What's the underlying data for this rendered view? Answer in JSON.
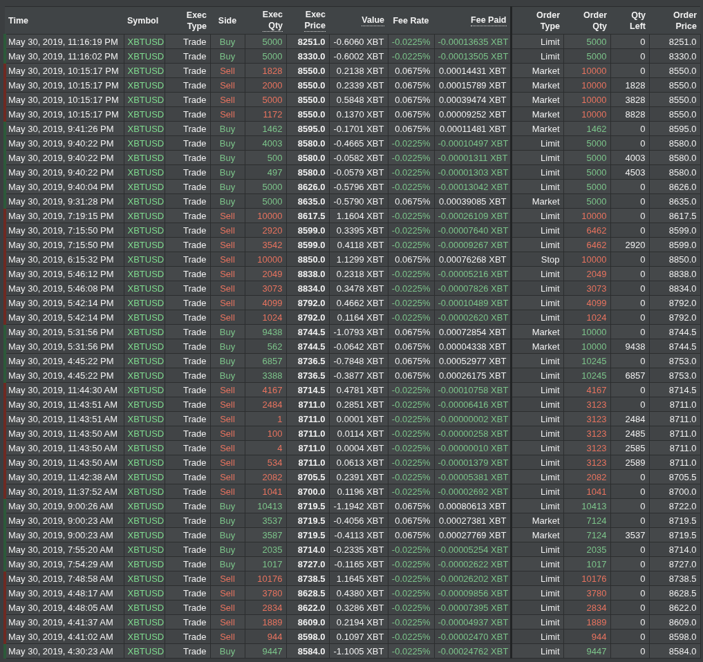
{
  "table": {
    "columns": [
      {
        "lines": [
          "Time"
        ],
        "kind": "time",
        "tooltip": false
      },
      {
        "lines": [
          "Symbol"
        ],
        "kind": "symbol",
        "tooltip": false
      },
      {
        "lines": [
          "Exec",
          "Type"
        ],
        "kind": "plain",
        "tooltip": false
      },
      {
        "lines": [
          "Side"
        ],
        "kind": "side",
        "tooltip": false
      },
      {
        "lines": [
          "Exec",
          "Qty"
        ],
        "kind": "side",
        "tooltip": true
      },
      {
        "lines": [
          "Exec",
          "Price"
        ],
        "kind": "bold",
        "tooltip": true
      },
      {
        "lines": [
          "Value"
        ],
        "kind": "plain",
        "tooltip": true
      },
      {
        "lines": [
          "Fee Rate"
        ],
        "kind": "fee",
        "tooltip": false
      },
      {
        "lines": [
          "Fee Paid"
        ],
        "kind": "fee",
        "tooltip": true
      },
      {
        "lines": [
          "Order",
          "Type"
        ],
        "kind": "plain",
        "tooltip": false
      },
      {
        "lines": [
          "Order",
          "Qty"
        ],
        "kind": "side",
        "tooltip": false
      },
      {
        "lines": [
          "Qty",
          "Left"
        ],
        "kind": "plain",
        "tooltip": false
      },
      {
        "lines": [
          "Order",
          "Price"
        ],
        "kind": "plain",
        "tooltip": false
      }
    ],
    "rows": [
      {
        "kind": "buy",
        "rebate": true,
        "cells": [
          "May 30, 2019, 11:16:19 PM",
          "XBTUSD",
          "Trade",
          "Buy",
          "5000",
          "8251.0",
          "-0.6060 XBT",
          "-0.0225%",
          "-0.00013635 XBT",
          "Limit",
          "5000",
          "0",
          "8251.0"
        ]
      },
      {
        "kind": "buy",
        "rebate": true,
        "cells": [
          "May 30, 2019, 11:16:02 PM",
          "XBTUSD",
          "Trade",
          "Buy",
          "5000",
          "8330.0",
          "-0.6002 XBT",
          "-0.0225%",
          "-0.00013505 XBT",
          "Limit",
          "5000",
          "0",
          "8330.0"
        ]
      },
      {
        "kind": "sell",
        "rebate": false,
        "cells": [
          "May 30, 2019, 10:15:17 PM",
          "XBTUSD",
          "Trade",
          "Sell",
          "1828",
          "8550.0",
          "0.2138 XBT",
          "0.0675%",
          "0.00014431 XBT",
          "Market",
          "10000",
          "0",
          "8550.0"
        ]
      },
      {
        "kind": "sell",
        "rebate": false,
        "cells": [
          "May 30, 2019, 10:15:17 PM",
          "XBTUSD",
          "Trade",
          "Sell",
          "2000",
          "8550.0",
          "0.2339 XBT",
          "0.0675%",
          "0.00015789 XBT",
          "Market",
          "10000",
          "1828",
          "8550.0"
        ]
      },
      {
        "kind": "sell",
        "rebate": false,
        "cells": [
          "May 30, 2019, 10:15:17 PM",
          "XBTUSD",
          "Trade",
          "Sell",
          "5000",
          "8550.0",
          "0.5848 XBT",
          "0.0675%",
          "0.00039474 XBT",
          "Market",
          "10000",
          "3828",
          "8550.0"
        ]
      },
      {
        "kind": "sell",
        "rebate": false,
        "cells": [
          "May 30, 2019, 10:15:17 PM",
          "XBTUSD",
          "Trade",
          "Sell",
          "1172",
          "8550.0",
          "0.1370 XBT",
          "0.0675%",
          "0.00009252 XBT",
          "Market",
          "10000",
          "8828",
          "8550.0"
        ]
      },
      {
        "kind": "buy",
        "rebate": false,
        "cells": [
          "May 30, 2019, 9:41:26 PM",
          "XBTUSD",
          "Trade",
          "Buy",
          "1462",
          "8595.0",
          "-0.1701 XBT",
          "0.0675%",
          "0.00011481 XBT",
          "Market",
          "1462",
          "0",
          "8595.0"
        ]
      },
      {
        "kind": "buy",
        "rebate": true,
        "cells": [
          "May 30, 2019, 9:40:22 PM",
          "XBTUSD",
          "Trade",
          "Buy",
          "4003",
          "8580.0",
          "-0.4665 XBT",
          "-0.0225%",
          "-0.00010497 XBT",
          "Limit",
          "5000",
          "0",
          "8580.0"
        ]
      },
      {
        "kind": "buy",
        "rebate": true,
        "cells": [
          "May 30, 2019, 9:40:22 PM",
          "XBTUSD",
          "Trade",
          "Buy",
          "500",
          "8580.0",
          "-0.0582 XBT",
          "-0.0225%",
          "-0.00001311 XBT",
          "Limit",
          "5000",
          "4003",
          "8580.0"
        ]
      },
      {
        "kind": "buy",
        "rebate": true,
        "cells": [
          "May 30, 2019, 9:40:22 PM",
          "XBTUSD",
          "Trade",
          "Buy",
          "497",
          "8580.0",
          "-0.0579 XBT",
          "-0.0225%",
          "-0.00001303 XBT",
          "Limit",
          "5000",
          "4503",
          "8580.0"
        ]
      },
      {
        "kind": "buy",
        "rebate": true,
        "cells": [
          "May 30, 2019, 9:40:04 PM",
          "XBTUSD",
          "Trade",
          "Buy",
          "5000",
          "8626.0",
          "-0.5796 XBT",
          "-0.0225%",
          "-0.00013042 XBT",
          "Limit",
          "5000",
          "0",
          "8626.0"
        ]
      },
      {
        "kind": "buy",
        "rebate": false,
        "cells": [
          "May 30, 2019, 9:31:28 PM",
          "XBTUSD",
          "Trade",
          "Buy",
          "5000",
          "8635.0",
          "-0.5790 XBT",
          "0.0675%",
          "0.00039085 XBT",
          "Market",
          "5000",
          "0",
          "8635.0"
        ]
      },
      {
        "kind": "sell",
        "rebate": true,
        "cells": [
          "May 30, 2019, 7:19:15 PM",
          "XBTUSD",
          "Trade",
          "Sell",
          "10000",
          "8617.5",
          "1.1604 XBT",
          "-0.0225%",
          "-0.00026109 XBT",
          "Limit",
          "10000",
          "0",
          "8617.5"
        ]
      },
      {
        "kind": "sell",
        "rebate": true,
        "cells": [
          "May 30, 2019, 7:15:50 PM",
          "XBTUSD",
          "Trade",
          "Sell",
          "2920",
          "8599.0",
          "0.3395 XBT",
          "-0.0225%",
          "-0.00007640 XBT",
          "Limit",
          "6462",
          "0",
          "8599.0"
        ]
      },
      {
        "kind": "sell",
        "rebate": true,
        "cells": [
          "May 30, 2019, 7:15:50 PM",
          "XBTUSD",
          "Trade",
          "Sell",
          "3542",
          "8599.0",
          "0.4118 XBT",
          "-0.0225%",
          "-0.00009267 XBT",
          "Limit",
          "6462",
          "2920",
          "8599.0"
        ]
      },
      {
        "kind": "sell",
        "rebate": false,
        "cells": [
          "May 30, 2019, 6:15:32 PM",
          "XBTUSD",
          "Trade",
          "Sell",
          "10000",
          "8850.0",
          "1.1299 XBT",
          "0.0675%",
          "0.00076268 XBT",
          "Stop",
          "10000",
          "0",
          "8850.0"
        ]
      },
      {
        "kind": "sell",
        "rebate": true,
        "cells": [
          "May 30, 2019, 5:46:12 PM",
          "XBTUSD",
          "Trade",
          "Sell",
          "2049",
          "8838.0",
          "0.2318 XBT",
          "-0.0225%",
          "-0.00005216 XBT",
          "Limit",
          "2049",
          "0",
          "8838.0"
        ]
      },
      {
        "kind": "sell",
        "rebate": true,
        "cells": [
          "May 30, 2019, 5:46:08 PM",
          "XBTUSD",
          "Trade",
          "Sell",
          "3073",
          "8834.0",
          "0.3478 XBT",
          "-0.0225%",
          "-0.00007826 XBT",
          "Limit",
          "3073",
          "0",
          "8834.0"
        ]
      },
      {
        "kind": "sell",
        "rebate": true,
        "cells": [
          "May 30, 2019, 5:42:14 PM",
          "XBTUSD",
          "Trade",
          "Sell",
          "4099",
          "8792.0",
          "0.4662 XBT",
          "-0.0225%",
          "-0.00010489 XBT",
          "Limit",
          "4099",
          "0",
          "8792.0"
        ]
      },
      {
        "kind": "sell",
        "rebate": true,
        "cells": [
          "May 30, 2019, 5:42:14 PM",
          "XBTUSD",
          "Trade",
          "Sell",
          "1024",
          "8792.0",
          "0.1164 XBT",
          "-0.0225%",
          "-0.00002620 XBT",
          "Limit",
          "1024",
          "0",
          "8792.0"
        ]
      },
      {
        "kind": "buy",
        "rebate": false,
        "cells": [
          "May 30, 2019, 5:31:56 PM",
          "XBTUSD",
          "Trade",
          "Buy",
          "9438",
          "8744.5",
          "-1.0793 XBT",
          "0.0675%",
          "0.00072854 XBT",
          "Market",
          "10000",
          "0",
          "8744.5"
        ]
      },
      {
        "kind": "buy",
        "rebate": false,
        "cells": [
          "May 30, 2019, 5:31:56 PM",
          "XBTUSD",
          "Trade",
          "Buy",
          "562",
          "8744.5",
          "-0.0642 XBT",
          "0.0675%",
          "0.00004338 XBT",
          "Market",
          "10000",
          "9438",
          "8744.5"
        ]
      },
      {
        "kind": "buy",
        "rebate": false,
        "cells": [
          "May 30, 2019, 4:45:22 PM",
          "XBTUSD",
          "Trade",
          "Buy",
          "6857",
          "8736.5",
          "-0.7848 XBT",
          "0.0675%",
          "0.00052977 XBT",
          "Limit",
          "10245",
          "0",
          "8753.0"
        ]
      },
      {
        "kind": "buy",
        "rebate": false,
        "cells": [
          "May 30, 2019, 4:45:22 PM",
          "XBTUSD",
          "Trade",
          "Buy",
          "3388",
          "8736.5",
          "-0.3877 XBT",
          "0.0675%",
          "0.00026175 XBT",
          "Limit",
          "10245",
          "6857",
          "8753.0"
        ]
      },
      {
        "kind": "sell",
        "rebate": true,
        "cells": [
          "May 30, 2019, 11:44:30 AM",
          "XBTUSD",
          "Trade",
          "Sell",
          "4167",
          "8714.5",
          "0.4781 XBT",
          "-0.0225%",
          "-0.00010758 XBT",
          "Limit",
          "4167",
          "0",
          "8714.5"
        ]
      },
      {
        "kind": "sell",
        "rebate": true,
        "cells": [
          "May 30, 2019, 11:43:51 AM",
          "XBTUSD",
          "Trade",
          "Sell",
          "2484",
          "8711.0",
          "0.2851 XBT",
          "-0.0225%",
          "-0.00006416 XBT",
          "Limit",
          "3123",
          "0",
          "8711.0"
        ]
      },
      {
        "kind": "sell",
        "rebate": true,
        "cells": [
          "May 30, 2019, 11:43:51 AM",
          "XBTUSD",
          "Trade",
          "Sell",
          "1",
          "8711.0",
          "0.0001 XBT",
          "-0.0225%",
          "-0.00000002 XBT",
          "Limit",
          "3123",
          "2484",
          "8711.0"
        ]
      },
      {
        "kind": "sell",
        "rebate": true,
        "cells": [
          "May 30, 2019, 11:43:50 AM",
          "XBTUSD",
          "Trade",
          "Sell",
          "100",
          "8711.0",
          "0.0114 XBT",
          "-0.0225%",
          "-0.00000258 XBT",
          "Limit",
          "3123",
          "2485",
          "8711.0"
        ]
      },
      {
        "kind": "sell",
        "rebate": true,
        "cells": [
          "May 30, 2019, 11:43:50 AM",
          "XBTUSD",
          "Trade",
          "Sell",
          "4",
          "8711.0",
          "0.0004 XBT",
          "-0.0225%",
          "-0.00000010 XBT",
          "Limit",
          "3123",
          "2585",
          "8711.0"
        ]
      },
      {
        "kind": "sell",
        "rebate": true,
        "cells": [
          "May 30, 2019, 11:43:50 AM",
          "XBTUSD",
          "Trade",
          "Sell",
          "534",
          "8711.0",
          "0.0613 XBT",
          "-0.0225%",
          "-0.00001379 XBT",
          "Limit",
          "3123",
          "2589",
          "8711.0"
        ]
      },
      {
        "kind": "sell",
        "rebate": true,
        "cells": [
          "May 30, 2019, 11:42:38 AM",
          "XBTUSD",
          "Trade",
          "Sell",
          "2082",
          "8705.5",
          "0.2391 XBT",
          "-0.0225%",
          "-0.00005381 XBT",
          "Limit",
          "2082",
          "0",
          "8705.5"
        ]
      },
      {
        "kind": "sell",
        "rebate": true,
        "cells": [
          "May 30, 2019, 11:37:52 AM",
          "XBTUSD",
          "Trade",
          "Sell",
          "1041",
          "8700.0",
          "0.1196 XBT",
          "-0.0225%",
          "-0.00002692 XBT",
          "Limit",
          "1041",
          "0",
          "8700.0"
        ]
      },
      {
        "kind": "buy",
        "rebate": false,
        "cells": [
          "May 30, 2019, 9:00:26 AM",
          "XBTUSD",
          "Trade",
          "Buy",
          "10413",
          "8719.5",
          "-1.1942 XBT",
          "0.0675%",
          "0.00080613 XBT",
          "Limit",
          "10413",
          "0",
          "8722.0"
        ]
      },
      {
        "kind": "buy",
        "rebate": false,
        "cells": [
          "May 30, 2019, 9:00:23 AM",
          "XBTUSD",
          "Trade",
          "Buy",
          "3537",
          "8719.5",
          "-0.4056 XBT",
          "0.0675%",
          "0.00027381 XBT",
          "Market",
          "7124",
          "0",
          "8719.5"
        ]
      },
      {
        "kind": "buy",
        "rebate": false,
        "cells": [
          "May 30, 2019, 9:00:23 AM",
          "XBTUSD",
          "Trade",
          "Buy",
          "3587",
          "8719.5",
          "-0.4113 XBT",
          "0.0675%",
          "0.00027769 XBT",
          "Market",
          "7124",
          "3537",
          "8719.5"
        ]
      },
      {
        "kind": "buy",
        "rebate": true,
        "cells": [
          "May 30, 2019, 7:55:20 AM",
          "XBTUSD",
          "Trade",
          "Buy",
          "2035",
          "8714.0",
          "-0.2335 XBT",
          "-0.0225%",
          "-0.00005254 XBT",
          "Limit",
          "2035",
          "0",
          "8714.0"
        ]
      },
      {
        "kind": "buy",
        "rebate": true,
        "cells": [
          "May 30, 2019, 7:54:29 AM",
          "XBTUSD",
          "Trade",
          "Buy",
          "1017",
          "8727.0",
          "-0.1165 XBT",
          "-0.0225%",
          "-0.00002622 XBT",
          "Limit",
          "1017",
          "0",
          "8727.0"
        ]
      },
      {
        "kind": "sell",
        "rebate": true,
        "cells": [
          "May 30, 2019, 7:48:58 AM",
          "XBTUSD",
          "Trade",
          "Sell",
          "10176",
          "8738.5",
          "1.1645 XBT",
          "-0.0225%",
          "-0.00026202 XBT",
          "Limit",
          "10176",
          "0",
          "8738.5"
        ]
      },
      {
        "kind": "sell",
        "rebate": true,
        "cells": [
          "May 30, 2019, 4:48:17 AM",
          "XBTUSD",
          "Trade",
          "Sell",
          "3780",
          "8628.5",
          "0.4380 XBT",
          "-0.0225%",
          "-0.00009856 XBT",
          "Limit",
          "3780",
          "0",
          "8628.5"
        ]
      },
      {
        "kind": "sell",
        "rebate": true,
        "cells": [
          "May 30, 2019, 4:48:05 AM",
          "XBTUSD",
          "Trade",
          "Sell",
          "2834",
          "8622.0",
          "0.3286 XBT",
          "-0.0225%",
          "-0.00007395 XBT",
          "Limit",
          "2834",
          "0",
          "8622.0"
        ]
      },
      {
        "kind": "sell",
        "rebate": true,
        "cells": [
          "May 30, 2019, 4:41:37 AM",
          "XBTUSD",
          "Trade",
          "Sell",
          "1889",
          "8609.0",
          "0.2194 XBT",
          "-0.0225%",
          "-0.00004937 XBT",
          "Limit",
          "1889",
          "0",
          "8609.0"
        ]
      },
      {
        "kind": "sell",
        "rebate": true,
        "cells": [
          "May 30, 2019, 4:41:02 AM",
          "XBTUSD",
          "Trade",
          "Sell",
          "944",
          "8598.0",
          "0.1097 XBT",
          "-0.0225%",
          "-0.00002470 XBT",
          "Limit",
          "944",
          "0",
          "8598.0"
        ]
      },
      {
        "kind": "buy",
        "rebate": true,
        "cells": [
          "May 30, 2019, 4:30:23 AM",
          "XBTUSD",
          "Trade",
          "Buy",
          "9447",
          "8584.0",
          "-1.1005 XBT",
          "-0.0225%",
          "-0.00024762 XBT",
          "Limit",
          "9447",
          "0",
          "8584.0"
        ]
      }
    ]
  }
}
